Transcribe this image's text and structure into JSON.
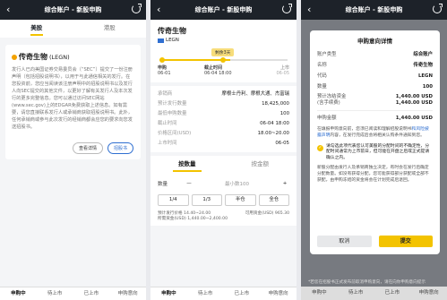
{
  "nav": {
    "title": "综合账户 - 新股申购"
  },
  "panel1": {
    "tabs": [
      "美股",
      "港股"
    ],
    "stock_name": "传奇生物",
    "stock_code": "(LEGN)",
    "description": "发行人已向美国证券交易委员会（“SEC”）提交了一份注册声明（包括招股说明书），以用于与此通信相关的发行。在您投资前，您应当阅读该注册声明中的招股说明书以及发行人向SEC提交的其他文件，以更好了解有关发行人及本次发行的更多完整信息。您可以通过访问SEC网站(www.sec.gov)上的EDGAR免费获取上述信息。如有需要，请您直接联系发行人或承销商获取招股说明书。此外，任何承销商或参与此次发行的经销商都会应您的要求向您发送招股书。",
    "btn_detail": "查看详情",
    "btn_prospectus": "招股书"
  },
  "panel2": {
    "stock_name": "传奇生物",
    "code": "LEGN",
    "countdown": "剩余3天",
    "timeline": [
      {
        "label": "申购",
        "date": "06-01"
      },
      {
        "label": "截止时间",
        "date": "06-04 18:00"
      },
      {
        "label": "上市",
        "date": "06-05"
      }
    ],
    "details": [
      {
        "k": "承销商",
        "v": "摩根士丹利、摩根大通、杰富瑞"
      },
      {
        "k": "预计发行数量",
        "v": "18,425,000"
      },
      {
        "k": "最低申购数量",
        "v": "100"
      },
      {
        "k": "截止时间",
        "v": "06-04 18:00"
      },
      {
        "k": "价格区间(USD)",
        "v": "18.00~20.00"
      },
      {
        "k": "上市时间",
        "v": "06-05"
      }
    ],
    "tabs": [
      "按数量",
      "按金额"
    ],
    "qty_label": "数量",
    "qty_minus": "—",
    "qty_value": "最小数100",
    "qty_plus": "+",
    "fracs": [
      "1/4",
      "1/3",
      "半仓",
      "全仓"
    ],
    "info_left": "预计发行价格 14.40~24.00",
    "info_left2": "所需资金(USD) 1,440.00~2,400.00",
    "info_right": "可用资金(USD) 965.30"
  },
  "panel3": {
    "modal_title": "申购意向详情",
    "rows": [
      {
        "k": "账户类型",
        "v": "综合账户"
      },
      {
        "k": "名称",
        "v": "传奇生物"
      },
      {
        "k": "代码",
        "v": "LEGN"
      },
      {
        "k": "数量",
        "v": "100"
      }
    ],
    "funds_k": "预计冻结资金",
    "funds_k2": "(含手续费)",
    "funds_v": "1,440.00 USD",
    "funds_v2": "1,440.00 USD",
    "amount_k": "申购金额",
    "amount_v": "1,440.00 USD",
    "note1": "在填报申购意向前，您须已阅读和理解招股说明书",
    "note1_link": "和风险披露声明",
    "note1_tail": "内容，在发行完成后会将相关认购条件通知到您。",
    "check_text": "请勾选此项代表您认可美股的分配时间的不确定性，分配时间通常为上市前日，但可能在开盘之后或正式提请确认之内。",
    "note2": "新股分配由发行人及承销商独立决定，有时会在发行后确定分配数量。如没有获得分配，您可能获得部分获配或全部不获配，由申购冻结的资金将会在计划完成后退回。",
    "btn_cancel": "取消",
    "btn_submit": "提交",
    "footer": "*若您在招股书正式发布前取消申购意向，请在向你申购意向提示",
    "bottom": [
      "申购中",
      "待上市",
      "已上市",
      "申购意向"
    ]
  },
  "bottom_tabs": [
    "申购中",
    "待上市",
    "已上市",
    "申购意向"
  ]
}
